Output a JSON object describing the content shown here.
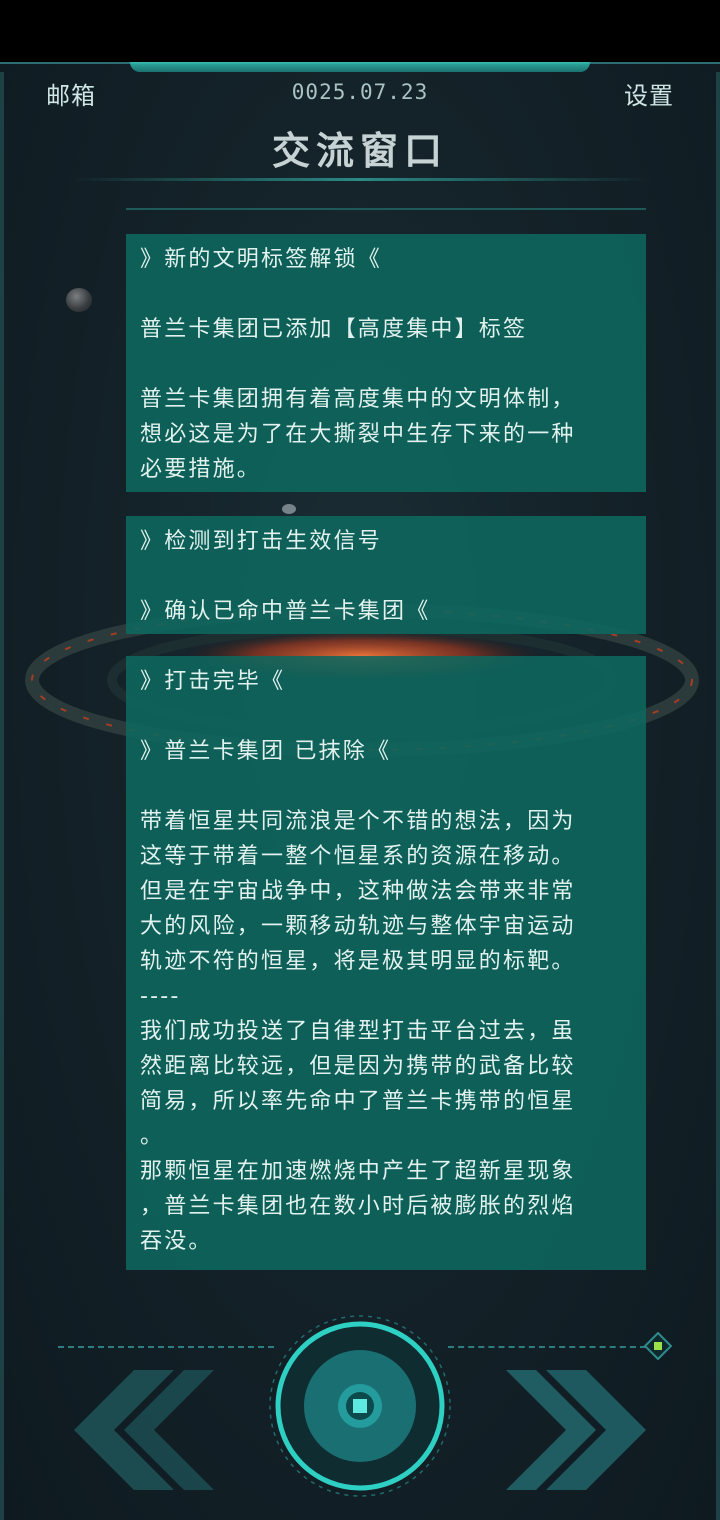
{
  "header": {
    "mailbox_label": "邮箱",
    "date": "0025.07.23",
    "settings_label": "设置",
    "title": "交流窗口"
  },
  "messages": [
    {
      "lines": [
        "》新的文明标签解锁《",
        "",
        "普兰卡集团已添加【高度集中】标签",
        "",
        "普兰卡集团拥有着高度集中的文明体制，",
        "想必这是为了在大撕裂中生存下来的一种",
        "必要措施。"
      ]
    },
    {
      "lines": [
        "》检测到打击生效信号",
        "",
        "》确认已命中普兰卡集团《"
      ]
    },
    {
      "lines": [
        "》打击完毕《",
        "",
        "》普兰卡集团 已抹除《",
        "",
        "带着恒星共同流浪是个不错的想法，因为",
        "这等于带着一整个恒星系的资源在移动。",
        "但是在宇宙战争中，这种做法会带来非常",
        "大的风险，一颗移动轨迹与整体宇宙运动",
        "轨迹不符的恒星，将是极其明显的标靶。",
        "----",
        "我们成功投送了自律型打击平台过去，虽",
        "然距离比较远，但是因为携带的武备比较",
        "简易，所以率先命中了普兰卡携带的恒星",
        "。",
        "那颗恒星在加速燃烧中产生了超新星现象",
        "，普兰卡集团也在数小时后被膨胀的烈焰",
        "吞没。"
      ]
    }
  ],
  "controls": {
    "prev_icon": "double-chevron-left-icon",
    "next_icon": "double-chevron-right-icon",
    "center_icon": "confirm-ring-button-icon",
    "corner_icon": "diamond-indicator-icon"
  },
  "colors": {
    "card_bg": "#0e685e",
    "accent": "#34c5b8",
    "indicator_green": "#9be24a"
  }
}
